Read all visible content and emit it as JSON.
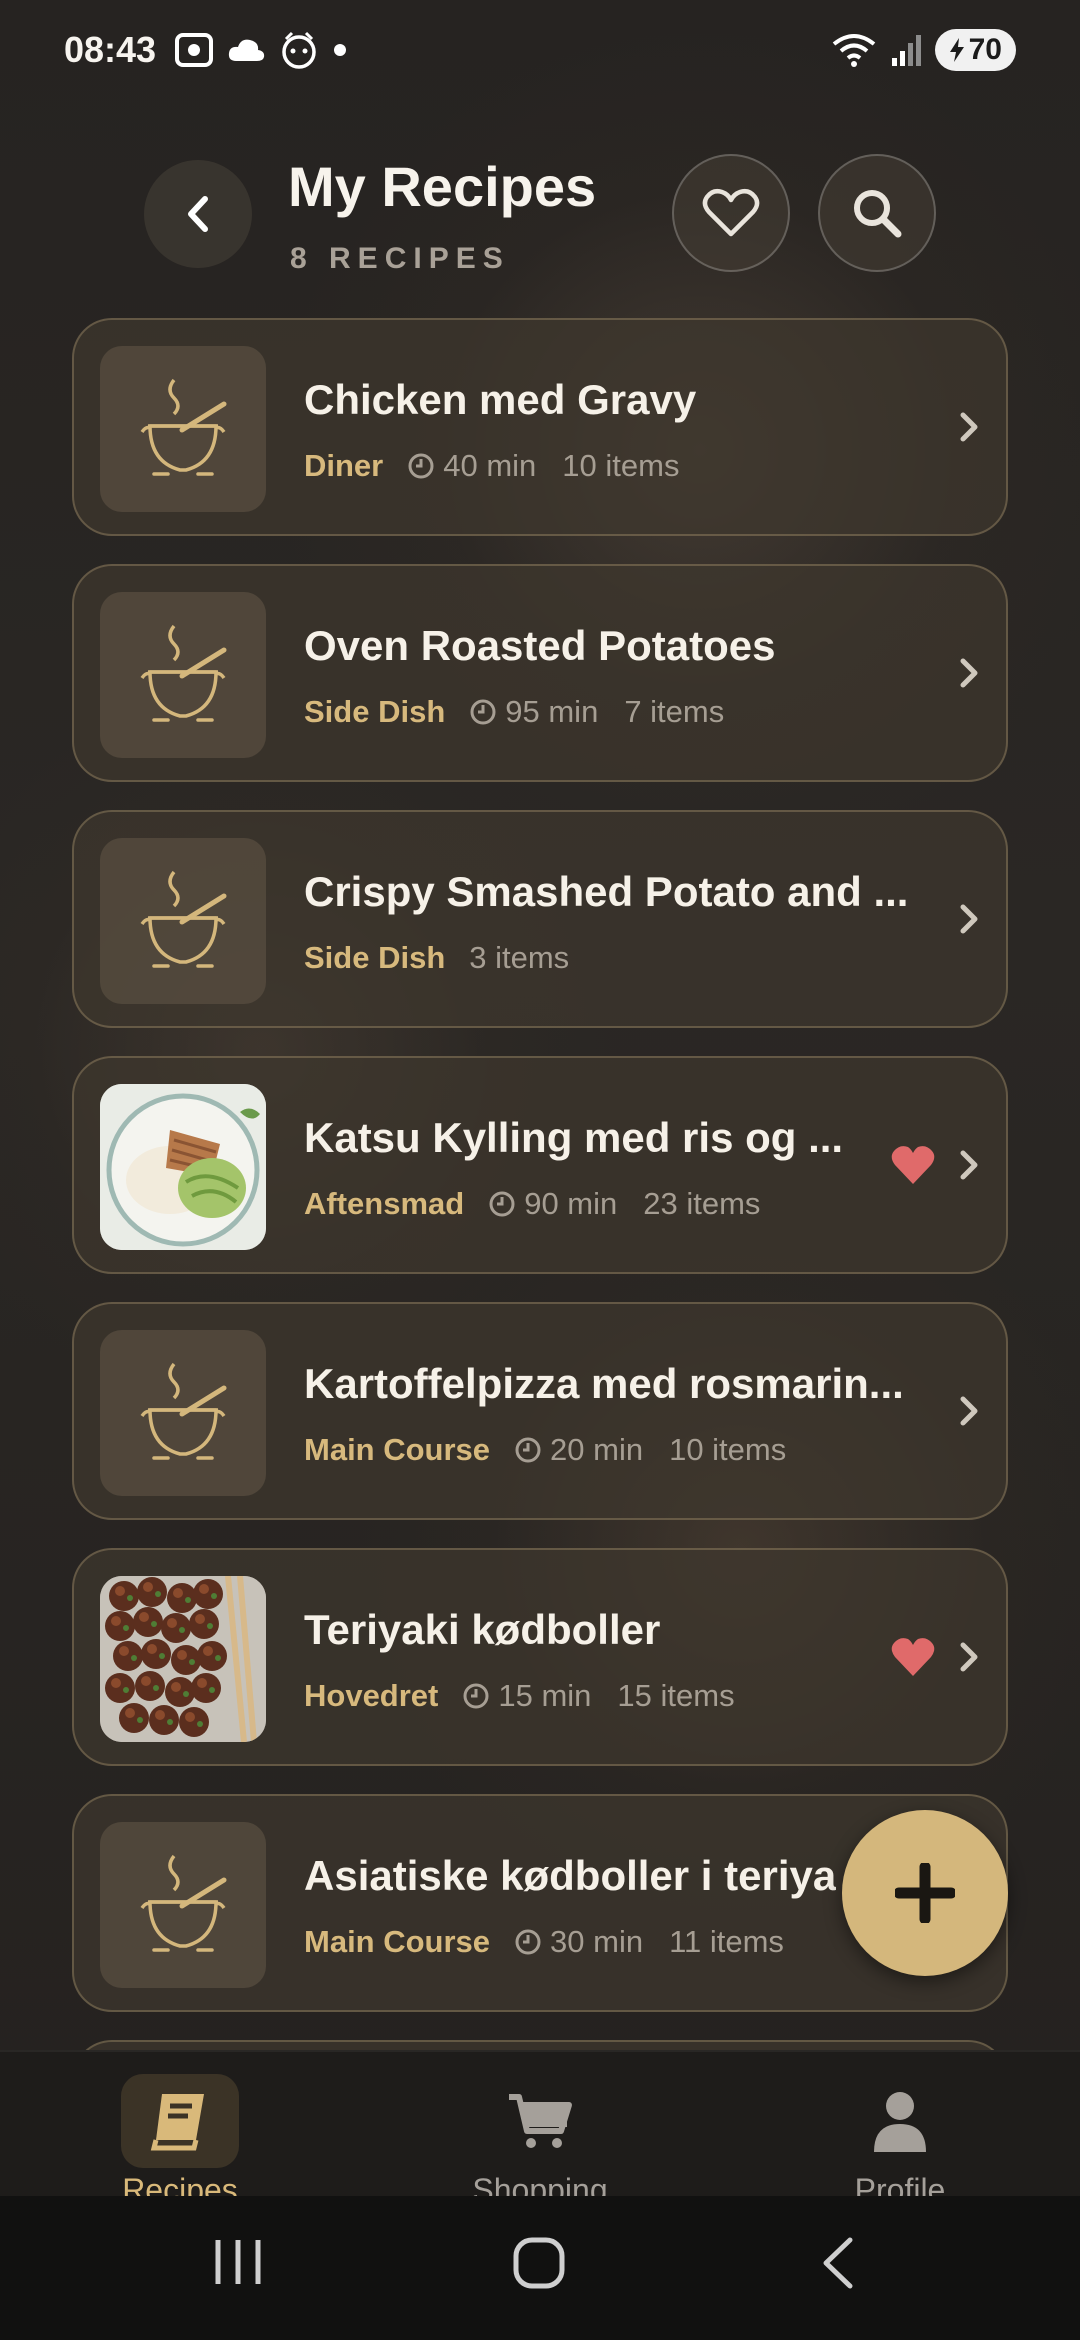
{
  "status_bar": {
    "time": "08:43",
    "battery": "70"
  },
  "header": {
    "title": "My Recipes",
    "subtitle": "8 RECIPES"
  },
  "recipes": [
    {
      "title": "Chicken med Gravy",
      "category": "Diner",
      "time": "40 min",
      "items": "10 items",
      "favorite": false,
      "image": "pot-icon"
    },
    {
      "title": "Oven Roasted Potatoes",
      "category": "Side Dish",
      "time": "95 min",
      "items": "7 items",
      "favorite": false,
      "image": "pot-icon"
    },
    {
      "title": "Crispy Smashed Potato and ...",
      "category": "Side Dish",
      "time": "",
      "items": "3 items",
      "favorite": false,
      "image": "pot-icon"
    },
    {
      "title": "Katsu Kylling med ris og ...",
      "category": "Aftensmad",
      "time": "90 min",
      "items": "23 items",
      "favorite": true,
      "image": "food-photo-katsu"
    },
    {
      "title": "Kartoffelpizza med rosmarin...",
      "category": "Main Course",
      "time": "20 min",
      "items": "10 items",
      "favorite": false,
      "image": "pot-icon"
    },
    {
      "title": "Teriyaki kødboller",
      "category": "Hovedret",
      "time": "15 min",
      "items": "15 items",
      "favorite": true,
      "image": "food-photo-meatballs"
    },
    {
      "title": "Asiatiske kødboller i teriya",
      "category": "Main Course",
      "time": "30 min",
      "items": "11 items",
      "favorite": false,
      "image": "pot-icon"
    }
  ],
  "bottom_nav": [
    {
      "label": "Recipes",
      "icon": "book-icon",
      "active": true
    },
    {
      "label": "Shopping",
      "icon": "cart-icon",
      "active": false
    },
    {
      "label": "Profile",
      "icon": "person-icon",
      "active": false
    }
  ],
  "colors": {
    "accent": "#d4b77c",
    "heart": "#e06a6a",
    "background": "#1f1d1b"
  }
}
